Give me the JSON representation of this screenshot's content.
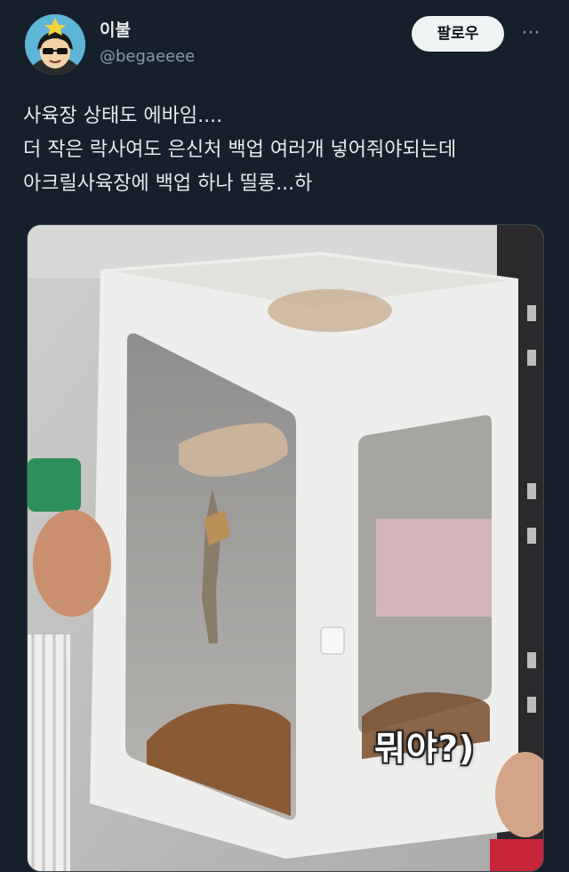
{
  "author": {
    "display_name": "이불",
    "handle": "@begaeeee"
  },
  "actions": {
    "follow_label": "팔로우",
    "more_label": "···"
  },
  "tweet": {
    "lines": [
      "사육장 상태도 에바임....",
      "더 작은 락사여도 은신처 백업 여러개 넣어줘야되는데",
      "아크릴사육장에 백업 하나 띨롱...하"
    ]
  },
  "media": {
    "caption": "뭐야?)"
  }
}
